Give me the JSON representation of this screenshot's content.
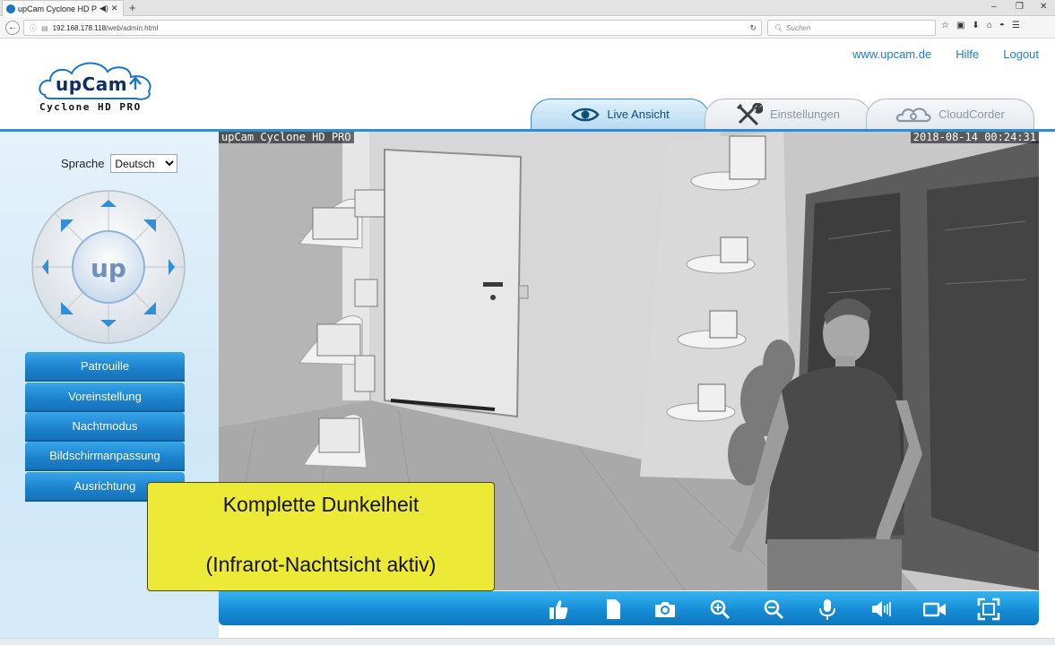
{
  "browser": {
    "tab_title": "upCam Cyclone HD P",
    "url_info": "ⓘ",
    "url_host": "192.168.178.118",
    "url_path": "/web/admin.html",
    "search_placeholder": "Suchen",
    "window_controls": [
      "–",
      "❐",
      "✕"
    ]
  },
  "header": {
    "logo_text": "upCam",
    "logo_subtitle": "Cyclone HD PRO",
    "links": [
      "www.upcam.de",
      "Hilfe",
      "Logout"
    ]
  },
  "main_tabs": [
    {
      "label": "Live Ansicht",
      "icon": "eye-icon",
      "active": true
    },
    {
      "label": "Einstellungen",
      "icon": "tools-icon",
      "active": false
    },
    {
      "label": "CloudCorder",
      "icon": "cloud-icon",
      "active": false
    }
  ],
  "sidebar": {
    "language_label": "Sprache",
    "language_value": "Deutsch",
    "ptz_center_label": "up",
    "menu": [
      "Patrouille",
      "Voreinstellung",
      "Nachtmodus",
      "Bildschirmanpassung",
      "Ausrichtung"
    ]
  },
  "video": {
    "osd_name": "upCam Cyclone HD PRO",
    "osd_timestamp": "2018-08-14 00:24:31"
  },
  "overlay": {
    "line1": "Komplette Dunkelheit",
    "line2": "(Infrarot-Nachtsicht aktiv)",
    "color": "#ecea37"
  },
  "controls": [
    "thumbs-up-icon",
    "document-icon",
    "camera-icon",
    "zoom-in-icon",
    "zoom-out-icon",
    "microphone-icon",
    "speaker-icon",
    "video-record-icon",
    "fullscreen-icon"
  ],
  "colors": {
    "accent": "#1b81cc",
    "link": "#1b7fc4"
  }
}
